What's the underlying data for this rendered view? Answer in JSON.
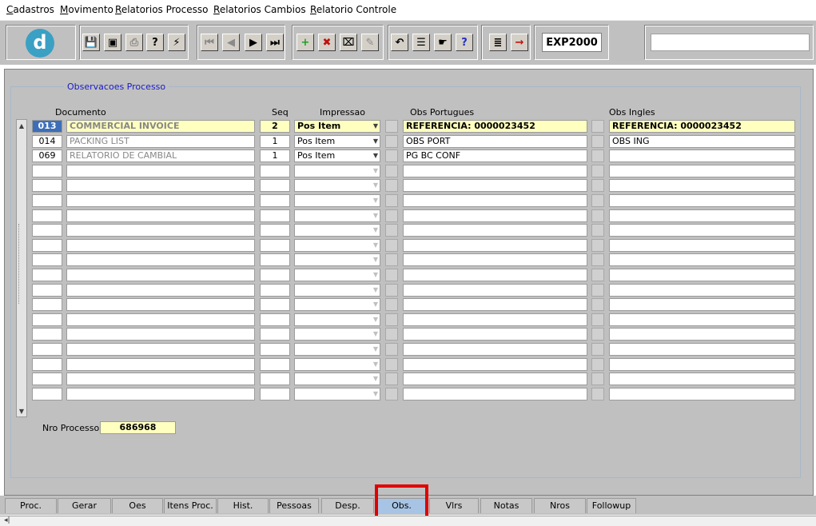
{
  "menu": [
    "Cadastros",
    "Movimento",
    "Relatorios Processo",
    "Relatorios Cambios",
    "Relatorio Controle"
  ],
  "toolbar": {
    "logo_letter": "d",
    "form_code": "EXP2000",
    "field_value": "",
    "buttons": [
      {
        "name": "save-icon",
        "glyph": "💾",
        "dim": true
      },
      {
        "name": "window-icon",
        "glyph": "▣",
        "dim": false
      },
      {
        "name": "print-icon",
        "glyph": "⎙",
        "dim": true
      },
      {
        "name": "query-icon",
        "glyph": "?",
        "dim": false
      },
      {
        "name": "execute-query-icon",
        "glyph": "⚡",
        "dim": false
      },
      {
        "name": "first-record-icon",
        "glyph": "⏮",
        "dim": true
      },
      {
        "name": "previous-record-icon",
        "glyph": "◀",
        "dim": true
      },
      {
        "name": "next-record-icon",
        "glyph": "▶",
        "dim": false
      },
      {
        "name": "last-record-icon",
        "glyph": "⏭",
        "dim": false
      },
      {
        "name": "insert-record-icon",
        "glyph": "+",
        "dim": false
      },
      {
        "name": "delete-record-icon",
        "glyph": "✖",
        "dim": false
      },
      {
        "name": "clear-record-icon",
        "glyph": "⌧",
        "dim": false
      },
      {
        "name": "lock-record-icon",
        "glyph": "✎",
        "dim": true
      },
      {
        "name": "undo-icon",
        "glyph": "↶",
        "dim": false
      },
      {
        "name": "list-icon",
        "glyph": "☰",
        "dim": false
      },
      {
        "name": "edit-icon",
        "glyph": "☛",
        "dim": false
      },
      {
        "name": "help-icon",
        "glyph": "?",
        "dim": false
      },
      {
        "name": "menu-icon",
        "glyph": "≣",
        "dim": false
      },
      {
        "name": "exit-icon",
        "glyph": "→",
        "dim": false
      }
    ]
  },
  "frame_title": "Observacoes Processo",
  "columns": {
    "documento": "Documento",
    "seq": "Seq",
    "impressao": "Impressao",
    "obs_portugues": "Obs Portugues",
    "obs_ingles": "Obs Ingles"
  },
  "rows": [
    {
      "code": "013",
      "doc": "COMMERCIAL INVOICE",
      "seq": "2",
      "impressao": "Pos Item",
      "obs_pt": "REFERENCIA: 0000023452",
      "obs_en": "REFERENCIA: 0000023452"
    },
    {
      "code": "014",
      "doc": "PACKING LIST",
      "seq": "1",
      "impressao": "Pos Item",
      "obs_pt": "OBS PORT",
      "obs_en": "OBS ING"
    },
    {
      "code": "069",
      "doc": "RELATORIO DE CAMBIAL",
      "seq": "1",
      "impressao": "Pos Item",
      "obs_pt": "PG BC CONF",
      "obs_en": ""
    }
  ],
  "empty_rows": 16,
  "nro_processo_label": "Nro Processo",
  "nro_processo": "686968",
  "tabs": [
    "Proc.",
    "Gerar",
    "Oes",
    "Itens Proc.",
    "Hist.",
    "Pessoas",
    "Desp.",
    "Obs.",
    "Vlrs",
    "Notas",
    "Nros",
    "Followup"
  ],
  "active_tab": "Obs.",
  "status_left": "◂|"
}
